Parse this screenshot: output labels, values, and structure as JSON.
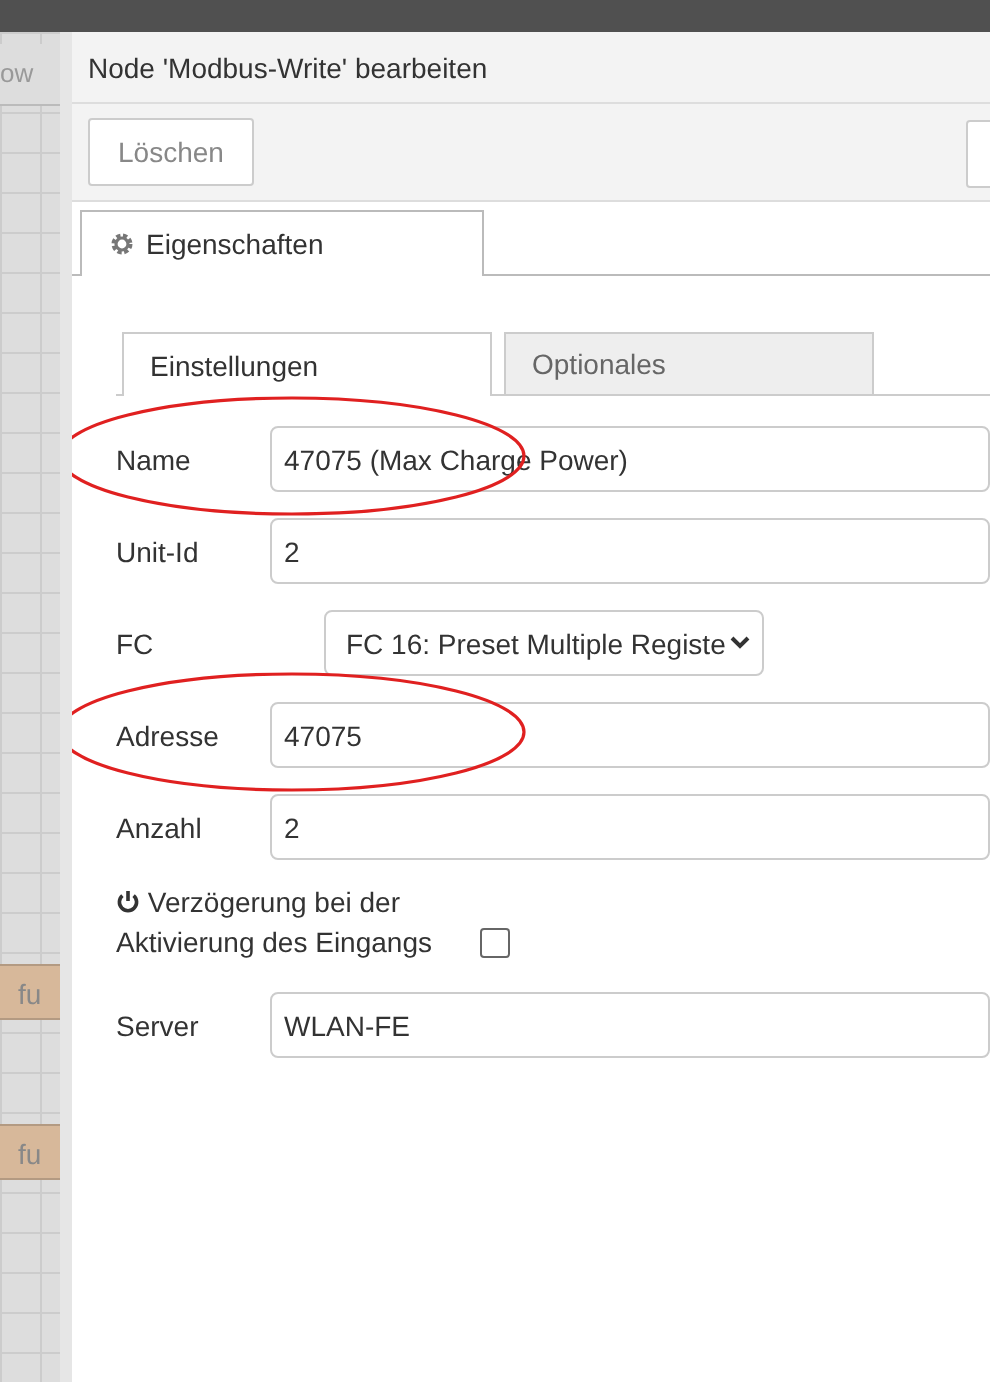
{
  "canvas": {
    "tab_fragment": "ow",
    "nodes": [
      {
        "label": "fu"
      },
      {
        "label": "fu"
      }
    ]
  },
  "dialog": {
    "title": "Node 'Modbus-Write' bearbeiten",
    "buttons": [
      {
        "label": "Löschen"
      }
    ],
    "tabs": [
      {
        "label": "Eigenschaften",
        "selected": true
      }
    ]
  },
  "form": {
    "tabs": [
      {
        "label": "Einstellungen",
        "selected": true
      },
      {
        "label": "Optionales",
        "selected": false
      }
    ],
    "fields": [
      {
        "kind": "text",
        "label": "Name",
        "value": "47075 (Max Charge Power)",
        "circled": true
      },
      {
        "kind": "text",
        "label": "Unit-Id",
        "value": "2",
        "circled": false
      },
      {
        "kind": "select",
        "label": "FC",
        "value": "FC 16: Preset Multiple Registe",
        "circled": false
      },
      {
        "kind": "text",
        "label": "Adresse",
        "value": "47075",
        "circled": true
      },
      {
        "kind": "text",
        "label": "Anzahl",
        "value": "2",
        "circled": false
      },
      {
        "kind": "checkbox",
        "label": "Verzögerung bei der Aktivierung des Eingangs",
        "checked": false,
        "circled": false
      },
      {
        "kind": "text",
        "label": "Server",
        "value": "WLAN-FE",
        "circled": false
      }
    ]
  }
}
